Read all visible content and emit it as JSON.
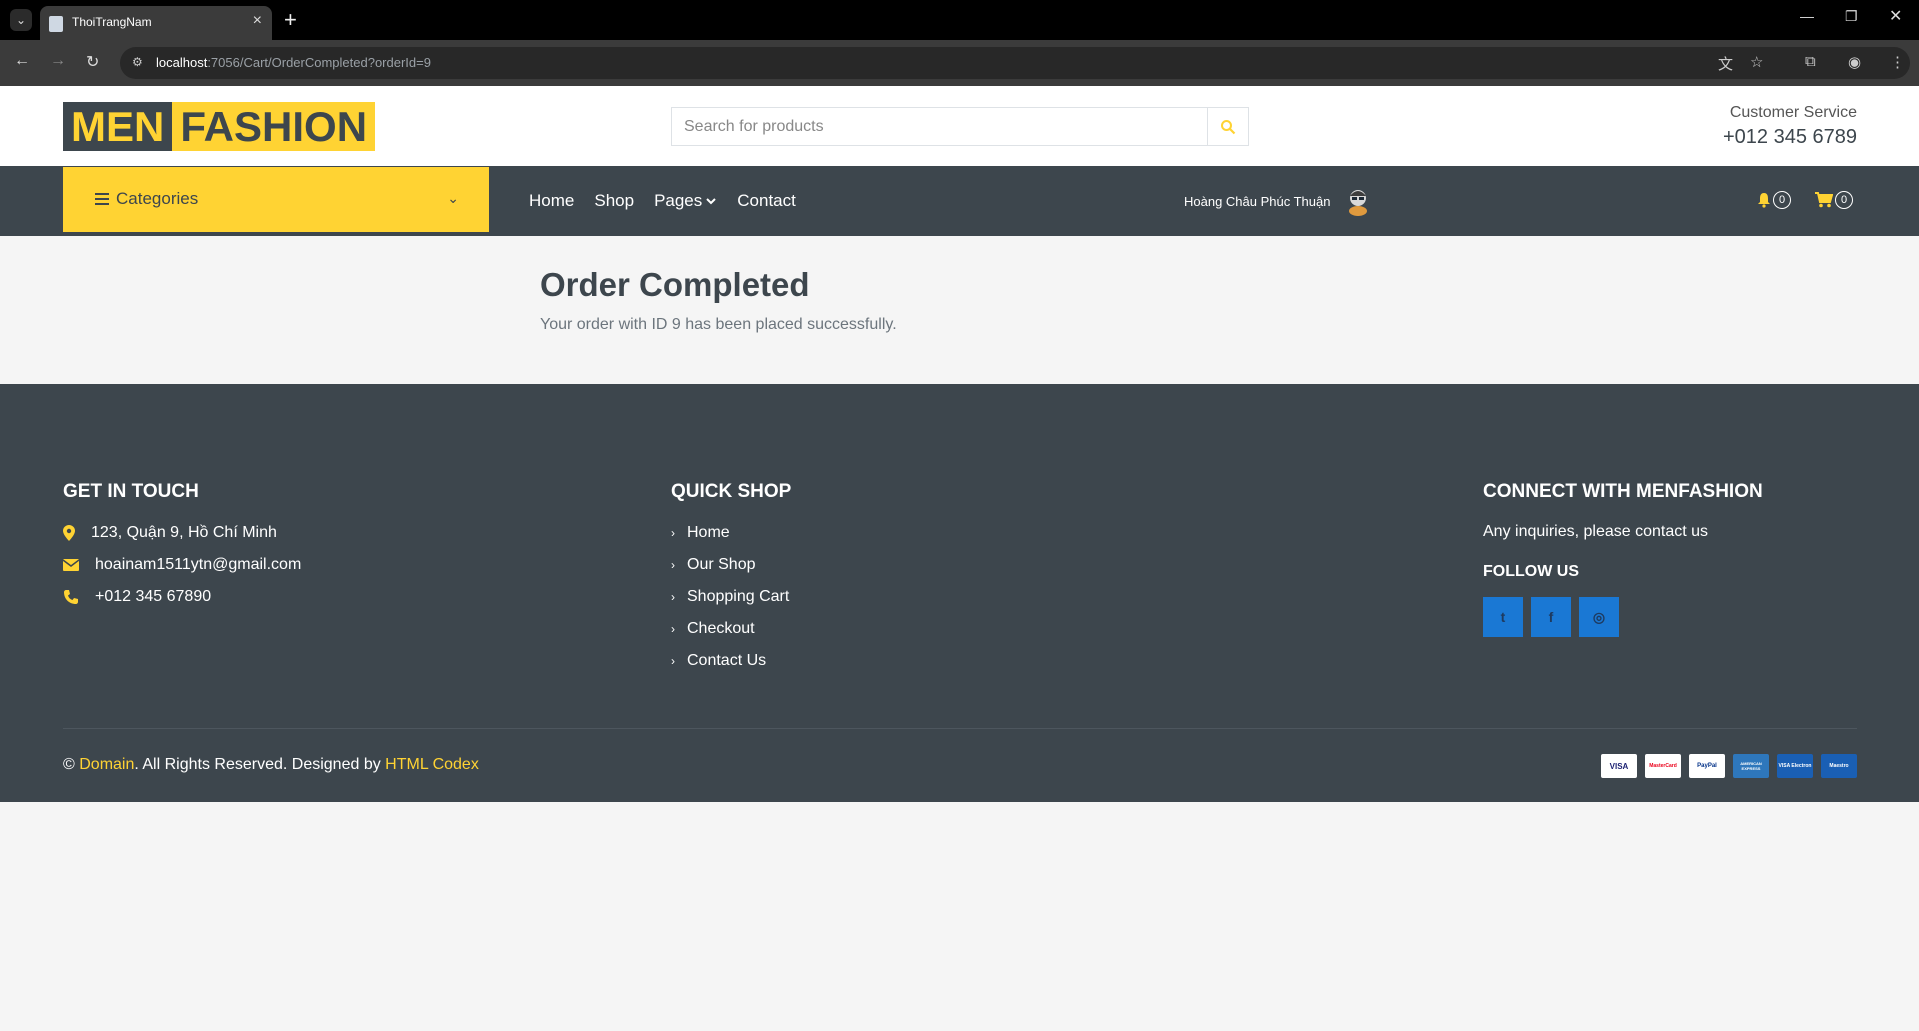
{
  "browser": {
    "tab_title": "ThoiTrangNam",
    "url_host": "localhost",
    "url_rest": ":7056/Cart/OrderCompleted?orderId=9"
  },
  "header": {
    "logo_part1": "MEN",
    "logo_part2": "FASHION",
    "search_placeholder": "Search for products",
    "customer_service_label": "Customer Service",
    "customer_service_phone": "+012 345 6789"
  },
  "navbar": {
    "categories_label": "Categories",
    "menu": [
      {
        "label": "Home"
      },
      {
        "label": "Shop"
      },
      {
        "label": "Pages"
      },
      {
        "label": "Contact"
      }
    ],
    "user_name": "Hoàng Châu Phúc Thuận",
    "notification_count": "0",
    "cart_count": "0"
  },
  "main": {
    "title": "Order Completed",
    "message": "Your order with ID 9 has been placed successfully."
  },
  "footer": {
    "get_in_touch": {
      "heading": "GET IN TOUCH",
      "address": "123, Quận 9, Hồ Chí Minh",
      "email": "hoainam1511ytn@gmail.com",
      "phone": "+012 345 67890"
    },
    "quick_shop": {
      "heading": "QUICK SHOP",
      "links": [
        {
          "label": "Home"
        },
        {
          "label": "Our Shop"
        },
        {
          "label": "Shopping Cart"
        },
        {
          "label": "Checkout"
        },
        {
          "label": "Contact Us"
        }
      ]
    },
    "connect": {
      "heading": "CONNECT WITH MENFASHION",
      "text": "Any inquiries, please contact us",
      "follow_heading": "FOLLOW US"
    },
    "copyright": {
      "prefix": "© ",
      "domain_link": "Domain",
      "middle": ". All Rights Reserved. Designed by ",
      "codex_link": "HTML Codex"
    },
    "payments": [
      "VISA",
      "MasterCard",
      "PayPal",
      "AMERICAN EXPRESS",
      "VISA Electron",
      "Maestro"
    ]
  },
  "colors": {
    "accent": "#ffd333",
    "dark": "#3d464d",
    "social": "#1a78d4"
  }
}
